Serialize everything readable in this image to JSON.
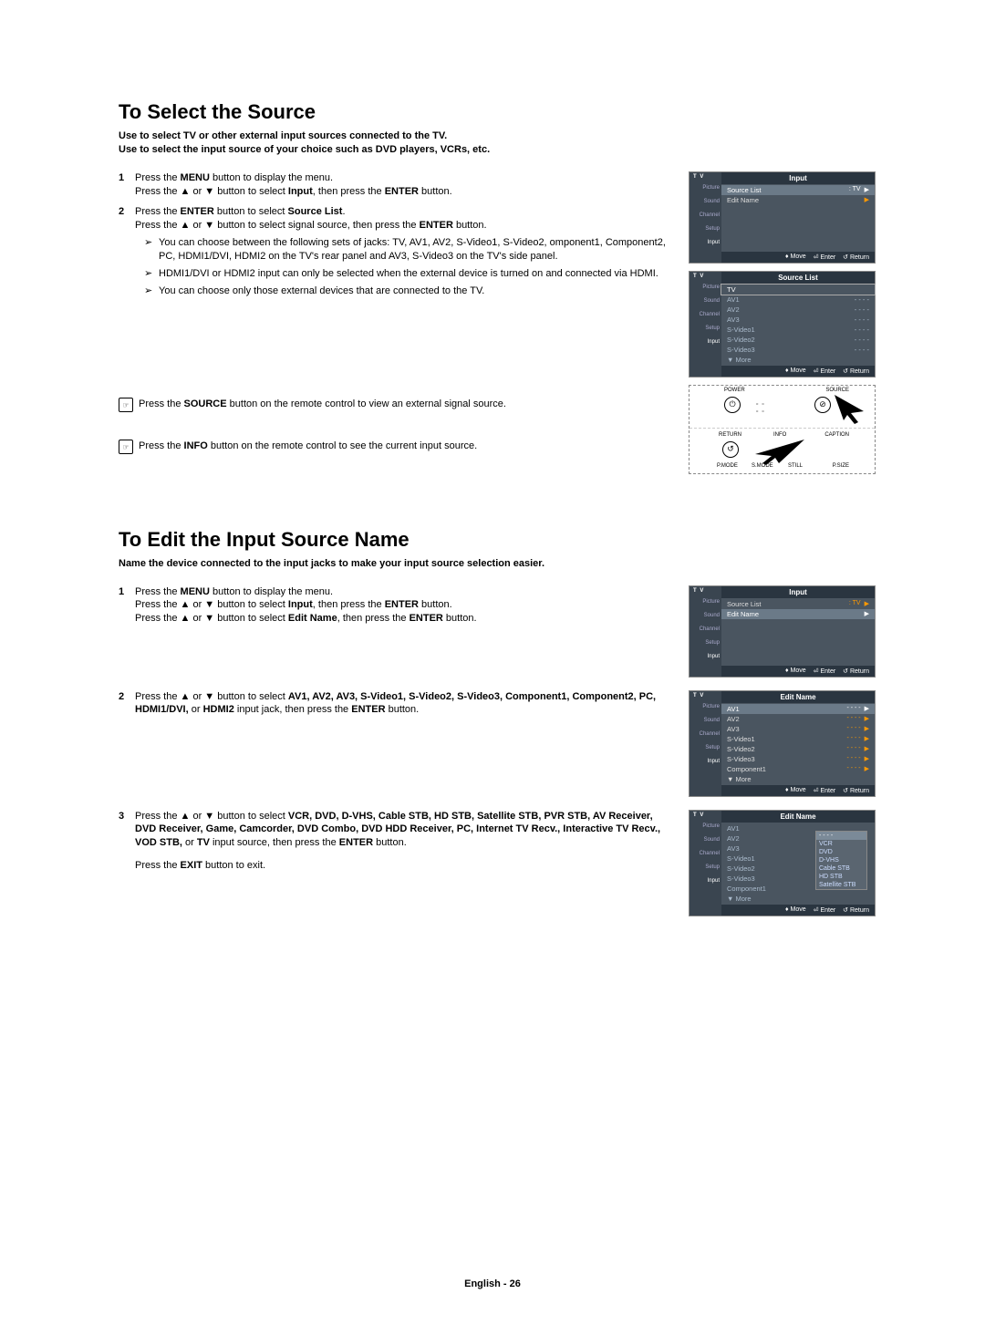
{
  "section1": {
    "heading": "To Select the Source",
    "intro1": "Use to select TV or other external input sources connected to the TV.",
    "intro2": "Use to select the input source of your choice such as DVD players, VCRs, etc.",
    "step1_pre": "Press the ",
    "step1_b1": "MENU",
    "step1_mid": " button to display the menu.",
    "step1_l2a": "Press the ▲ or ▼ button to select ",
    "step1_l2b": "Input",
    "step1_l2c": ", then press the ",
    "step1_l2d": "ENTER",
    "step1_l2e": " button.",
    "step2_a": "Press the ",
    "step2_b": "ENTER",
    "step2_c": " button to select ",
    "step2_d": "Source List",
    "step2_e": ".",
    "step2_l2a": "Press the ▲ or ▼ button to select signal source, then press the ",
    "step2_l2b": "ENTER",
    "step2_l2c": " button.",
    "sub1": "You can choose between the following sets of jacks: TV, AV1, AV2, S-Video1, S-Video2, omponent1, Component2, PC, HDMI1/DVI, HDMI2 on the TV's rear panel and AV3, S-Video3 on the TV's side panel.",
    "sub2": "HDMI1/DVI or HDMI2 input can only be selected when the external device is turned on and connected via HDMI.",
    "sub3": "You can choose only those external devices that are connected to the TV.",
    "note1a": "Press the ",
    "note1b": "SOURCE",
    "note1c": " button on the remote control to view an external signal source.",
    "note2a": "Press the ",
    "note2b": "INFO",
    "note2c": " button on the remote control to see the current input source."
  },
  "section2": {
    "heading": "To Edit the Input Source Name",
    "intro": "Name the device connected to the input jacks to make your input source selection easier.",
    "step1_a": "Press the ",
    "step1_b": "MENU",
    "step1_c": " button to display the menu.",
    "step1_l2a": "Press the ▲ or ▼ button to select ",
    "step1_l2b": "Input",
    "step1_l2c": ", then press the ",
    "step1_l2d": "ENTER",
    "step1_l2e": " button.",
    "step1_l3a": "Press the ▲ or ▼ button to select ",
    "step1_l3b": "Edit Name",
    "step1_l3c": ", then press the ",
    "step1_l3d": "ENTER",
    "step1_l3e": " button.",
    "step2_a": "Press the ▲ or ▼ button to select ",
    "step2_b": "AV1, AV2, AV3,  S-Video1, S-Video2, S-Video3, Component1, Component2, PC, HDMI1/DVI,",
    "step2_c": " or ",
    "step2_d": "HDMI2",
    "step2_e": " input jack, then press the ",
    "step2_f": "ENTER",
    "step2_g": " button.",
    "step3_a": "Press the ▲ or ▼ button to select ",
    "step3_b": "VCR, DVD, D-VHS, Cable STB, HD STB, Satellite STB, PVR STB, AV Receiver, DVD Receiver, Game, Camcorder, DVD Combo, DVD HDD Receiver, PC, Internet TV Recv., Interactive TV Recv., VOD STB,",
    "step3_c": " or ",
    "step3_d": "TV",
    "step3_e": " input source, then press the ",
    "step3_f": "ENTER",
    "step3_g": " button.",
    "exit_a": "Press the ",
    "exit_b": "EXIT",
    "exit_c": " button to exit."
  },
  "osd": {
    "tv": "T V",
    "side": [
      "Picture",
      "Sound",
      "Channel",
      "Setup",
      "Input"
    ],
    "input_title": "Input",
    "source_list": "Source List",
    "edit_name": "Edit Name",
    "tv_val": ": TV",
    "dashes": "- - - -",
    "sourcelist_title": "Source List",
    "sources": [
      "TV",
      "AV1",
      "AV2",
      "AV3",
      "S-Video1",
      "S-Video2",
      "S-Video3"
    ],
    "more": "▼ More",
    "foot_move": "Move",
    "foot_enter": "Enter",
    "foot_return": "Return",
    "editname_title": "Edit Name",
    "edit_items": [
      "AV1",
      "AV2",
      "AV3",
      "S-Video1",
      "S-Video2",
      "S-Video3",
      "Component1"
    ],
    "popup_items": [
      "- - - -",
      "VCR",
      "DVD",
      "D-VHS",
      "Cable STB",
      "HD STB",
      "Satellite STB"
    ]
  },
  "remote": {
    "power": "POWER",
    "source": "SOURCE",
    "return": "RETURN",
    "info": "INFO",
    "caption": "CAPTION",
    "pmode": "P.MODE",
    "smode": "S.MODE",
    "still": "STILL",
    "psize": "P.SIZE"
  },
  "footer": "English - 26",
  "arrow": "➢"
}
